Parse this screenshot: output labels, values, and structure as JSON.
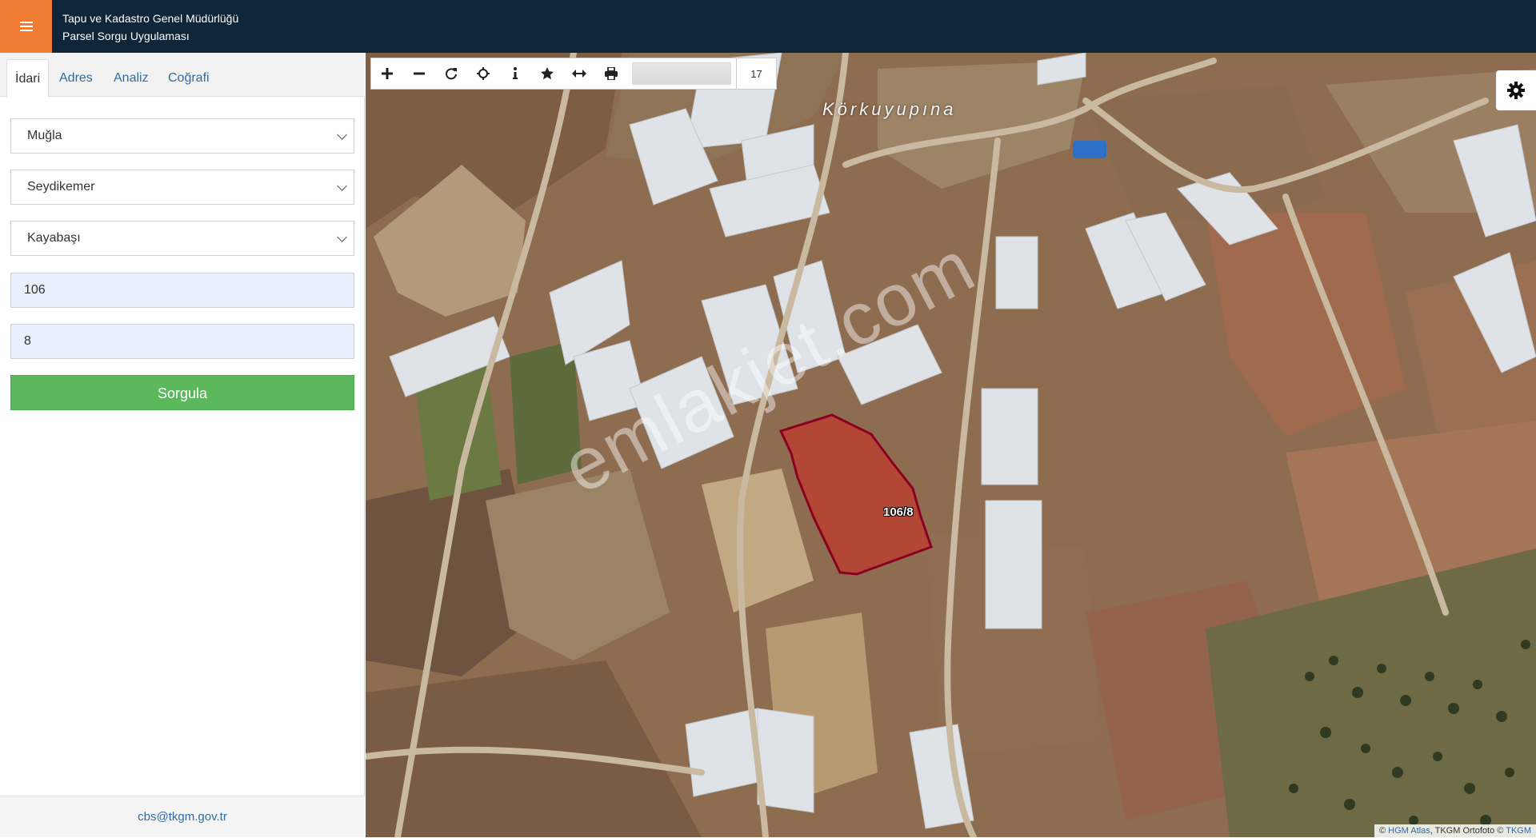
{
  "header": {
    "title_line1": "Tapu ve Kadastro Genel Müdürlüğü",
    "title_line2": "Parsel Sorgu Uygulaması"
  },
  "tabs": [
    {
      "label": "İdari"
    },
    {
      "label": "Adres"
    },
    {
      "label": "Analiz"
    },
    {
      "label": "Coğrafi"
    }
  ],
  "form": {
    "il": "Muğla",
    "ilce": "Seydikemer",
    "mahalle": "Kayabaşı",
    "ada": "106",
    "parsel": "8",
    "submit_label": "Sorgula"
  },
  "footer": {
    "email": "cbs@tkgm.gov.tr"
  },
  "map": {
    "zoom_level": "17",
    "place_label": "Körkuyupına",
    "parcel_label": "106/8",
    "watermark": "emlakjet.com",
    "attribution_prefix": "©",
    "attribution_link1": "HGM Atlas",
    "attribution_middle": ", TKGM Ortofoto ©",
    "attribution_link2": "TKGM"
  },
  "colors": {
    "header_bg": "#0f2538",
    "menu_accent": "#f07c33",
    "submit_bg": "#5cb85c",
    "parcel_fill": "#c0392b",
    "parcel_stroke": "#8b0020"
  },
  "icons": [
    "menu-icon",
    "zoom-in-icon",
    "zoom-out-icon",
    "refresh-icon",
    "locate-icon",
    "info-icon",
    "star-icon",
    "measure-icon",
    "print-icon",
    "gear-icon"
  ]
}
